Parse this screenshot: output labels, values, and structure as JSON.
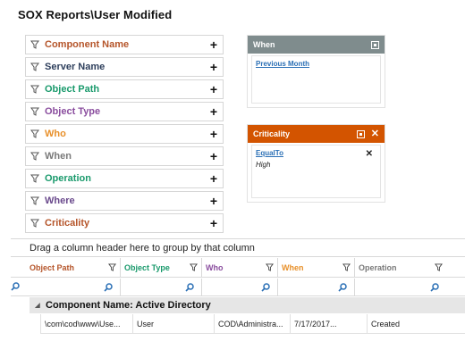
{
  "page": {
    "title": "SOX Reports\\User Modified"
  },
  "filters": [
    {
      "label": "Component Name",
      "color": "#b5552a"
    },
    {
      "label": "Server Name",
      "color": "#2e3f5c"
    },
    {
      "label": "Object Path",
      "color": "#1a9a6c"
    },
    {
      "label": "Object Type",
      "color": "#8a4d9e"
    },
    {
      "label": "Who",
      "color": "#e8902a"
    },
    {
      "label": "When",
      "color": "#7a7a7a"
    },
    {
      "label": "Operation",
      "color": "#1a9a6c"
    },
    {
      "label": "Where",
      "color": "#6a4a8c"
    },
    {
      "label": "Criticality",
      "color": "#b5552a"
    }
  ],
  "filter_add_symbol": "+",
  "when_panel": {
    "title": "When",
    "header_color": "#7f8c8d",
    "value_link": "Previous Month"
  },
  "criticality_panel": {
    "title": "Criticality",
    "header_color": "#d35400",
    "operator_link": "EqualTo",
    "value": "High",
    "remove_symbol": "✕"
  },
  "grid": {
    "group_hint": "Drag a column header here to group by that column",
    "columns": [
      {
        "label": "Object Path",
        "color": "#b5552a"
      },
      {
        "label": "Object Type",
        "color": "#1a9a6c"
      },
      {
        "label": "Who",
        "color": "#8a4d9e"
      },
      {
        "label": "When",
        "color": "#e8902a"
      },
      {
        "label": "Operation",
        "color": "#7a7a7a"
      }
    ],
    "group_row": "Component Name: Active Directory",
    "rows": [
      {
        "object_path": "\\com\\cod\\www\\Use...",
        "object_type": "User",
        "who": "COD\\Administra...",
        "when": "7/17/2017...",
        "operation": "Created"
      }
    ]
  }
}
